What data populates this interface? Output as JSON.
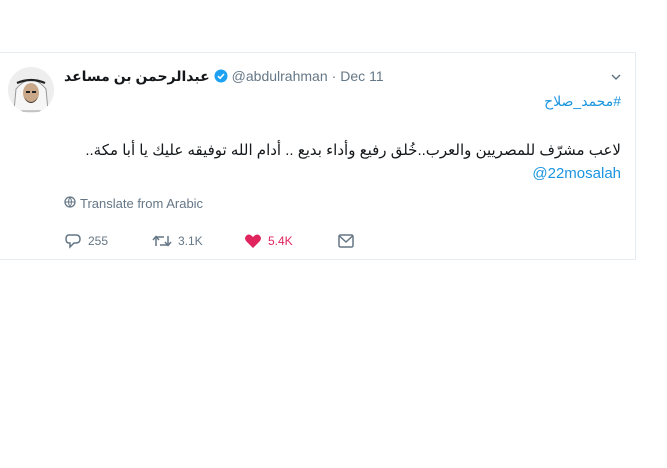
{
  "tweet": {
    "display_name": "عبدالرحمن بن مساعد",
    "handle": "@abdulrahman",
    "separator": "·",
    "date": "Dec 11",
    "hashtag": "#محمد_صلاح",
    "text": "لاعب مشرّف للمصريين والعرب..خُلق رفيع وأداء بديع .. أدام الله توفيقه عليك يا أبا مكة..",
    "mention": "@22mosalah",
    "translate_label": "Translate from Arabic",
    "reply_count": "255",
    "retweet_count": "3.1K",
    "like_count": "5.4K",
    "icons": {
      "verified": "verified-badge-icon",
      "caret": "chevron-down-icon",
      "translate": "globe-icon",
      "reply": "reply-icon",
      "retweet": "retweet-icon",
      "like": "heart-icon",
      "dm": "direct-message-icon"
    },
    "colors": {
      "link": "#1b95e0",
      "like": "#e0245e",
      "muted": "#657786",
      "text": "#14171a"
    }
  }
}
